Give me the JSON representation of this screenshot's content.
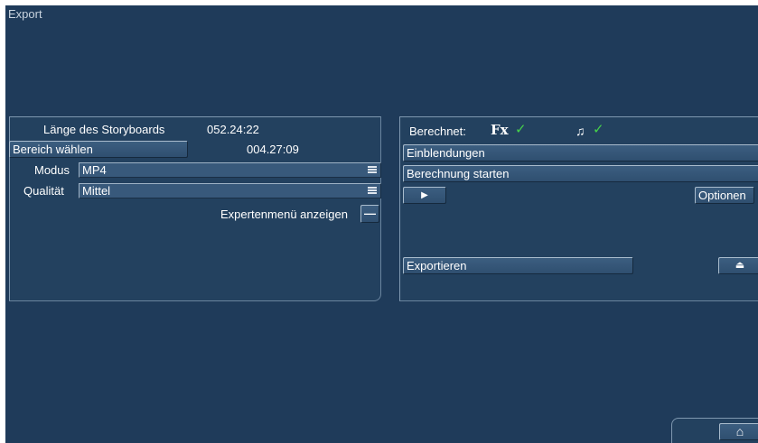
{
  "window": {
    "title": "Export"
  },
  "left_panel": {
    "storyboard_length_label": "Länge des Storyboards",
    "storyboard_length_value": "052.24:22",
    "range_button": "Bereich wählen",
    "range_value": "004.27:09",
    "mode_label": "Modus",
    "mode_value": "MP4",
    "quality_label": "Qualität",
    "quality_value": "Mittel",
    "expert_menu_label": "Expertenmenü anzeigen",
    "expert_toggle_symbol": "—"
  },
  "right_panel": {
    "computed_label": "Berechnet:",
    "fx_label": "Fx",
    "fx_check": "✓",
    "audio_icon_glyph": "♫",
    "audio_check": "✓",
    "overlays_button": "Einblendungen",
    "start_render_button": "Berechnung starten",
    "play_symbol": "▶",
    "options_button": "Optionen",
    "export_button": "Exportieren",
    "eject_symbol": "⏏"
  },
  "bottom": {
    "home_symbol": "⌂"
  },
  "colors": {
    "background": "#1f3b5a",
    "panel": "#23415f",
    "check": "#46d14a"
  }
}
